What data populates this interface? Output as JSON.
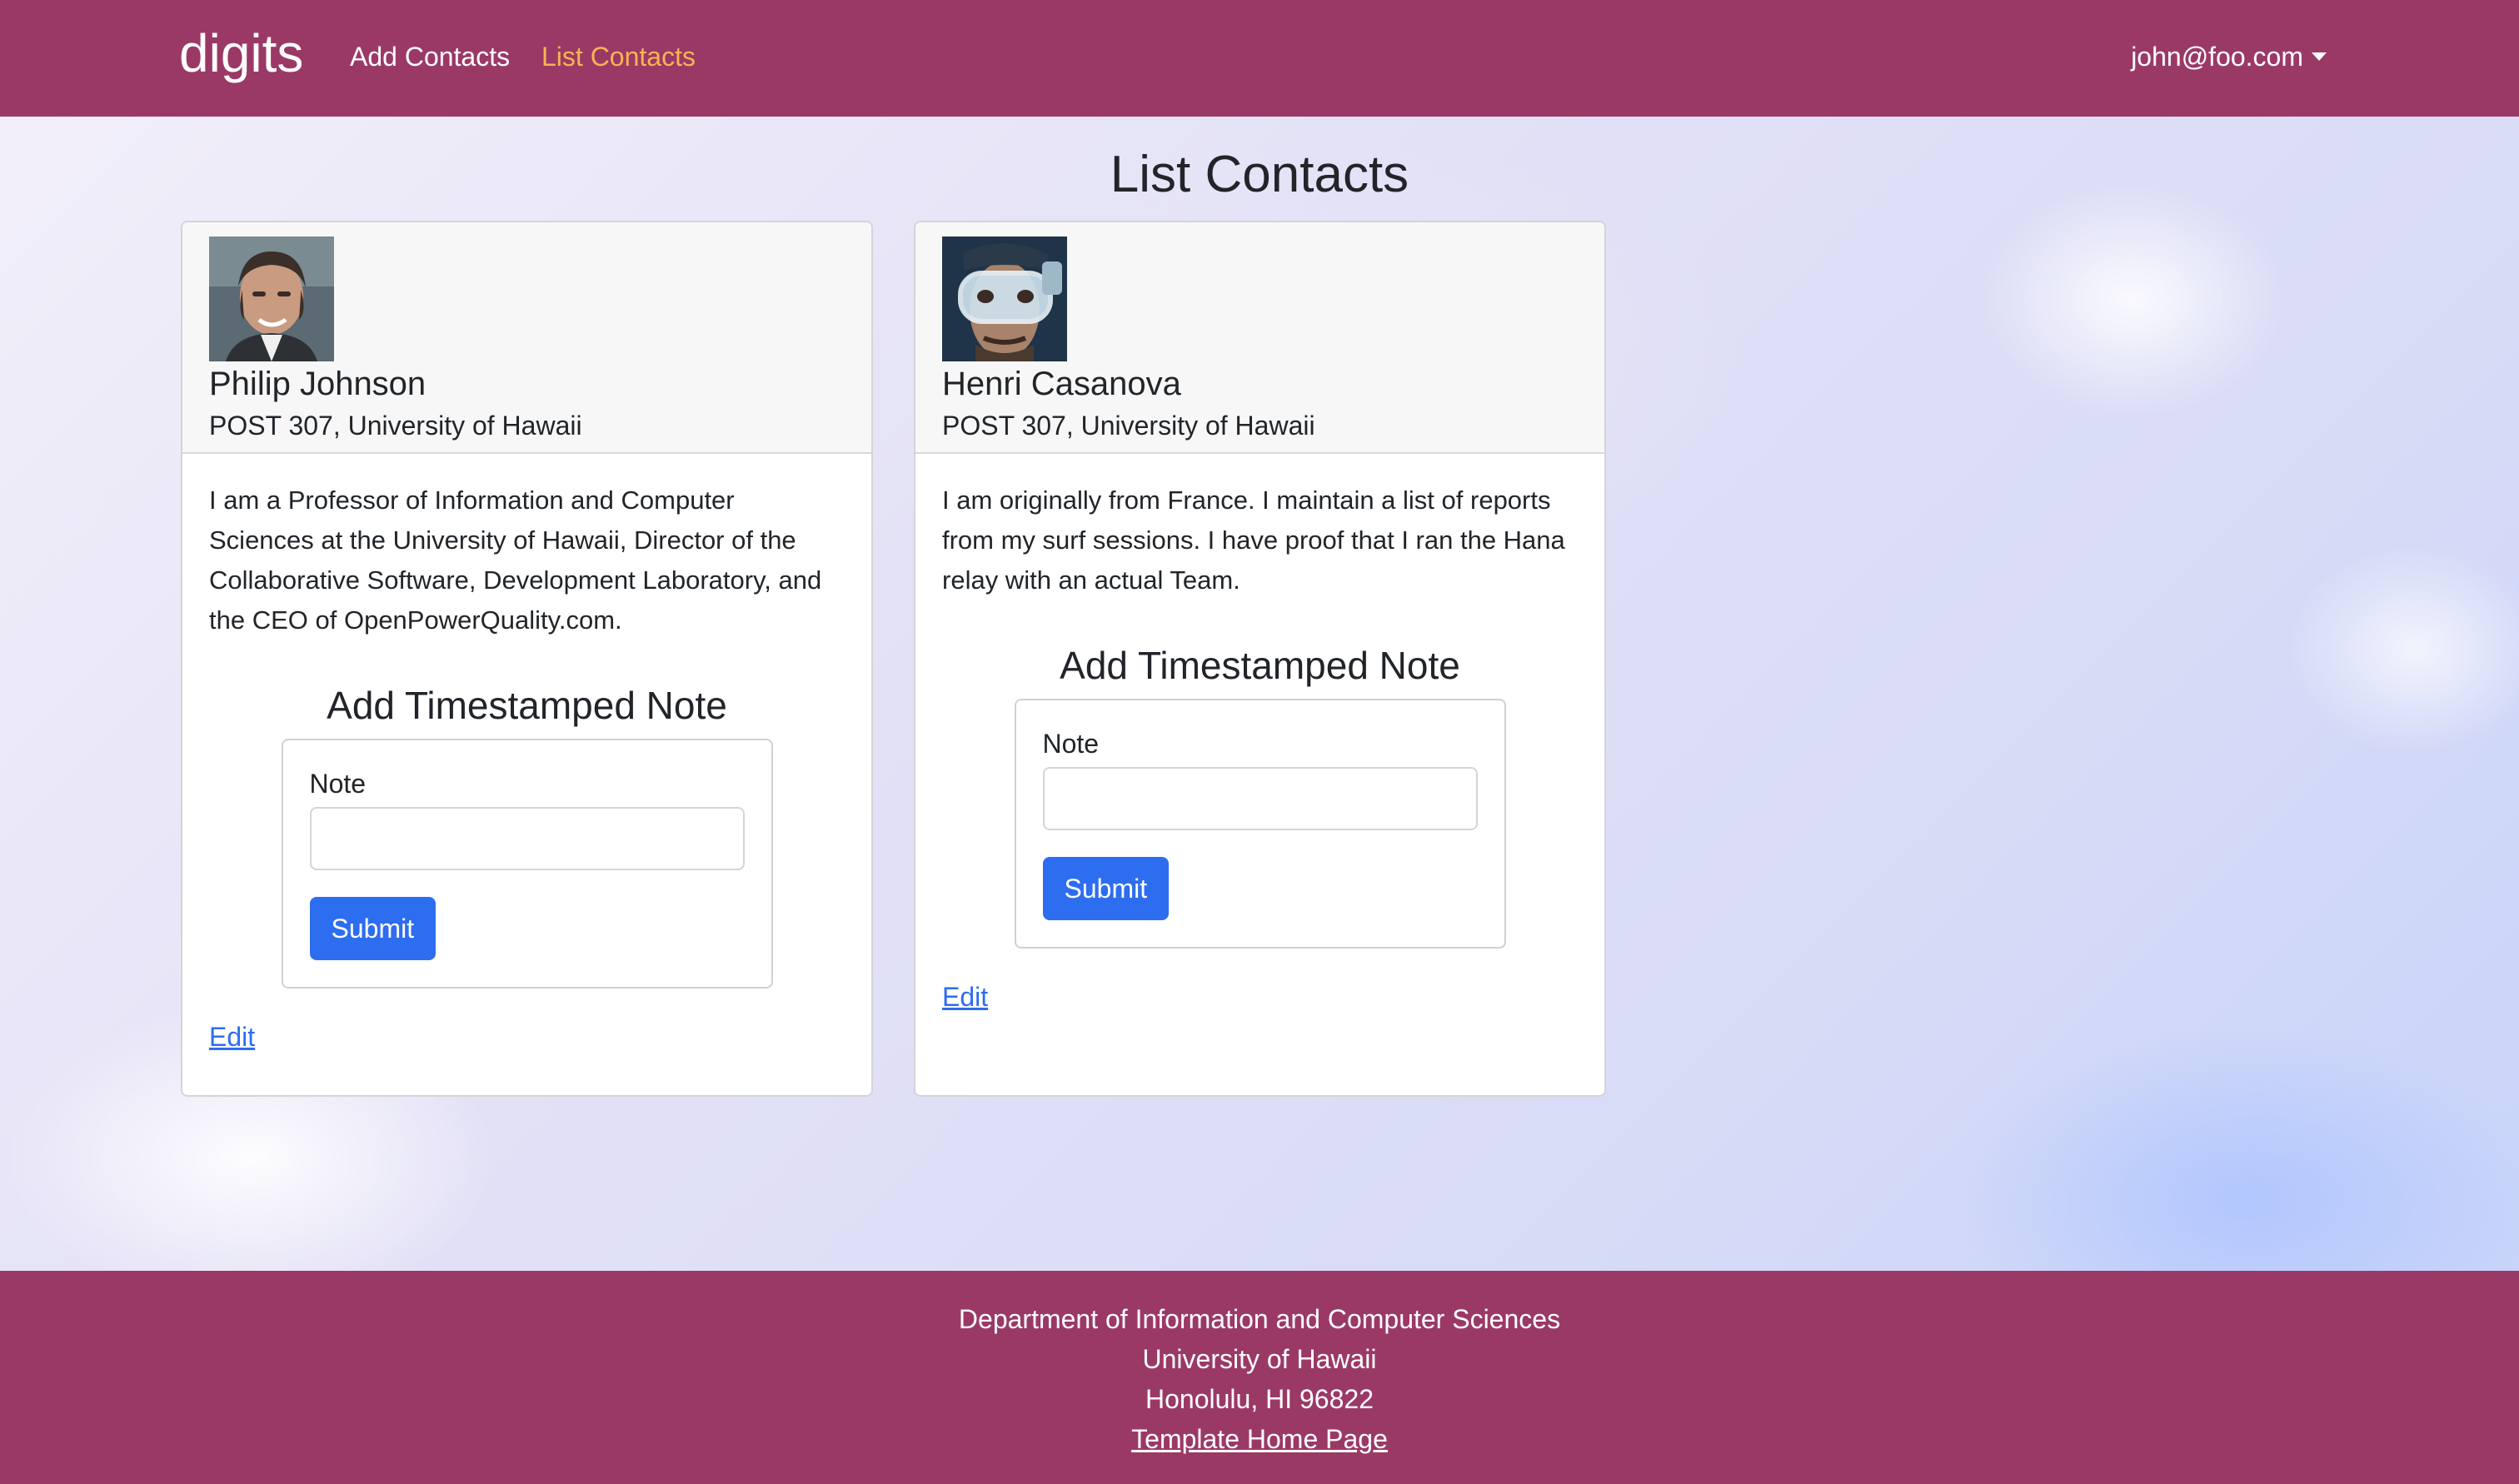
{
  "navbar": {
    "brand": "digits",
    "links": [
      {
        "label": "Add Contacts",
        "active": false
      },
      {
        "label": "List Contacts",
        "active": true
      }
    ],
    "user": "john@foo.com",
    "background_color": "#9b3966",
    "active_link_color": "#f4b552"
  },
  "page": {
    "title": "List Contacts"
  },
  "contacts": [
    {
      "name": "Philip Johnson",
      "address": "POST 307, University of Hawaii",
      "description": "I am a Professor of Information and Computer Sciences at the University of Hawaii, Director of the Collaborative Software, Development Laboratory, and the CEO of OpenPowerQuality.com.",
      "note_title": "Add Timestamped Note",
      "note_label": "Note",
      "note_value": "",
      "submit_label": "Submit",
      "edit_label": "Edit"
    },
    {
      "name": "Henri Casanova",
      "address": "POST 307, University of Hawaii",
      "description": "I am originally from France. I maintain a list of reports from my surf sessions. I have proof that I ran the Hana relay with an actual Team.",
      "note_title": "Add Timestamped Note",
      "note_label": "Note",
      "note_value": "",
      "submit_label": "Submit",
      "edit_label": "Edit"
    }
  ],
  "footer": {
    "lines": [
      "Department of Information and Computer Sciences",
      "University of Hawaii",
      "Honolulu, HI 96822"
    ],
    "link": "Template Home Page"
  },
  "colors": {
    "primary_button": "#2d6df0"
  }
}
